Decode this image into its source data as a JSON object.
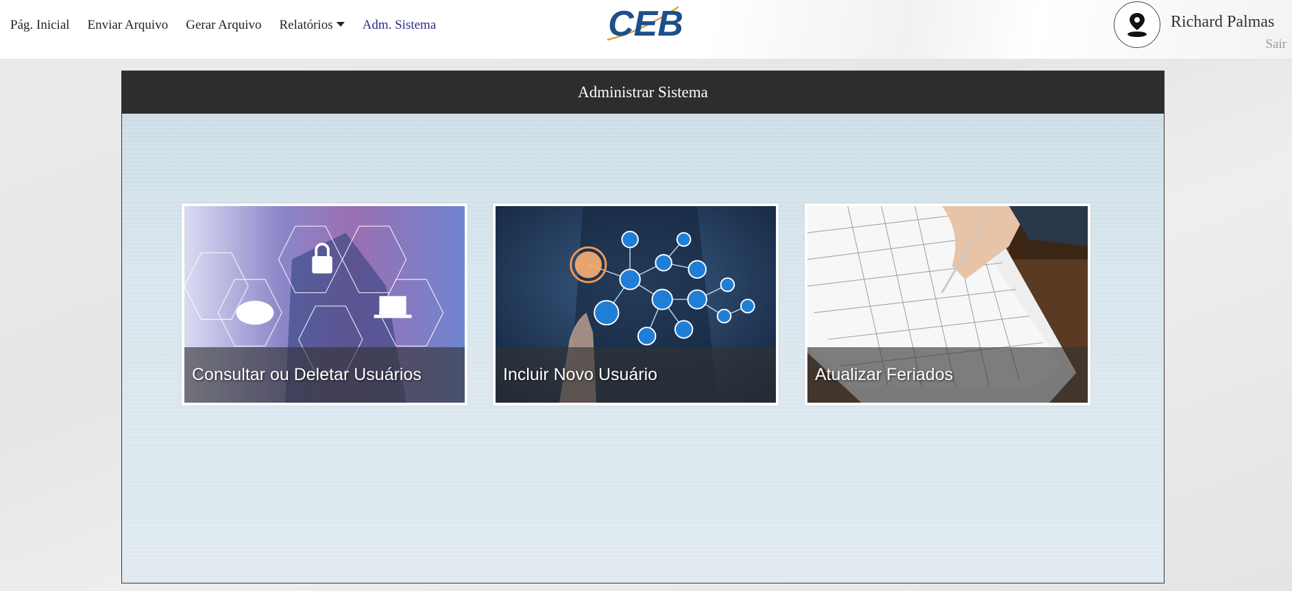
{
  "nav": {
    "items": [
      {
        "label": "Pág. Inicial"
      },
      {
        "label": "Enviar Arquivo"
      },
      {
        "label": "Gerar Arquivo"
      },
      {
        "label": "Relatórios"
      },
      {
        "label": "Adm. Sistema"
      }
    ]
  },
  "logo": {
    "text": "CEB"
  },
  "user": {
    "name": "Richard Palmas",
    "logout_label": "Sair"
  },
  "panel": {
    "title": "Administrar Sistema"
  },
  "cards": [
    {
      "label": "Consultar ou Deletar Usuários",
      "icon": "security-network-icon"
    },
    {
      "label": "Incluir Novo Usuário",
      "icon": "user-network-icon"
    },
    {
      "label": "Atualizar Feriados",
      "icon": "calendar-icon"
    }
  ],
  "colors": {
    "accent": "#2b2b8f",
    "header_bg": "#2d2d2d",
    "logo_blue": "#1d4f8c",
    "logo_gold": "#d8a23a"
  }
}
